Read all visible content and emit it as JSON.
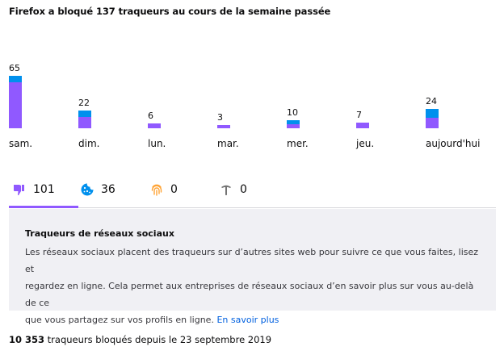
{
  "title": "Firefox a bloqué 137 traqueurs au cours de la semaine passée",
  "colors": {
    "social": "#9059ff",
    "cookies": "#0090ed",
    "fingerprinters": "#ffa436",
    "cryptominers": "#737373",
    "tab_underline": "#9059ff",
    "link": "#0060df"
  },
  "chart_data": {
    "type": "bar",
    "stacked": true,
    "categories": [
      "sam.",
      "dim.",
      "lun.",
      "mar.",
      "mer.",
      "jeu.",
      "aujourd'hui"
    ],
    "totals": [
      "65",
      "22",
      "6",
      "3",
      "10",
      "7",
      "24"
    ],
    "series": [
      {
        "key": "social",
        "color": "#9059ff",
        "values": [
          57,
          14,
          6,
          3,
          5,
          7,
          13
        ]
      },
      {
        "key": "cookies",
        "color": "#0090ed",
        "values": [
          8,
          8,
          0,
          0,
          5,
          0,
          11
        ]
      }
    ],
    "ylim": [
      0,
      65
    ]
  },
  "tabs": [
    {
      "icon": "thumbs-down-icon",
      "count": "101",
      "color": "#9059ff",
      "selected": true
    },
    {
      "icon": "cookie-icon",
      "count": "36",
      "color": "#0090ed",
      "selected": false
    },
    {
      "icon": "fingerprint-icon",
      "count": "0",
      "color": "#ffa436",
      "selected": false
    },
    {
      "icon": "pickaxe-icon",
      "count": "0",
      "color": "#737373",
      "selected": false
    }
  ],
  "panel": {
    "title": "Traqueurs de réseaux sociaux",
    "body_line1": "Les réseaux sociaux placent des traqueurs sur d’autres sites web pour suivre ce que vous faites, lisez et",
    "body_line2": "regardez en ligne. Cela permet aux entreprises de réseaux sociaux d’en savoir plus sur vous au-delà de ce",
    "body_line3": "que vous partagez sur vos profils en ligne.",
    "link": "En savoir plus"
  },
  "footer": {
    "count": "10 353",
    "text": " traqueurs bloqués depuis le 23 septembre 2019"
  }
}
